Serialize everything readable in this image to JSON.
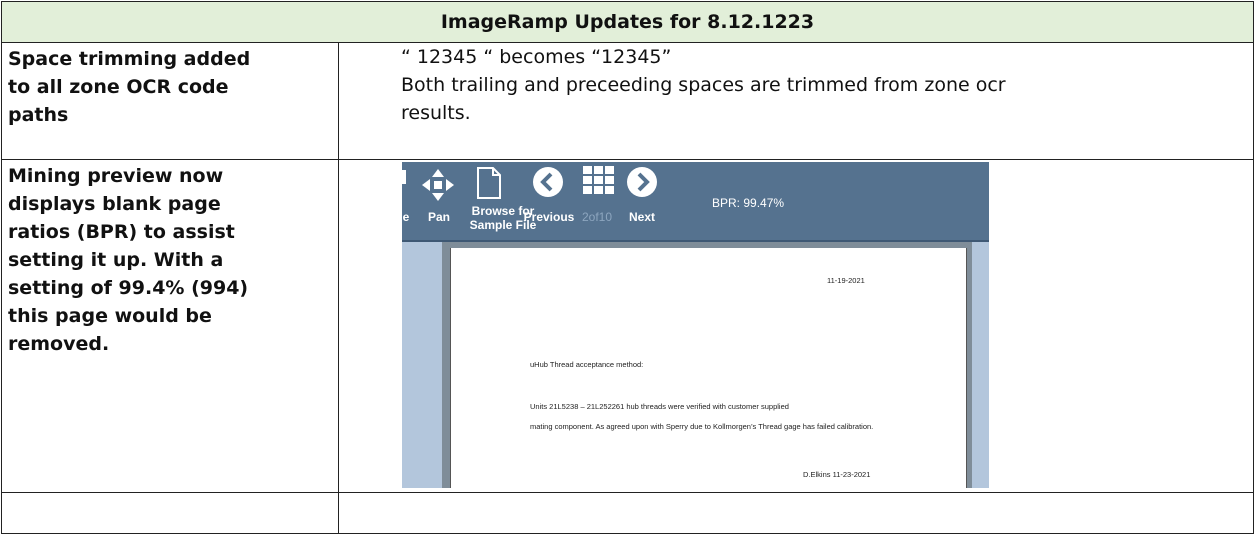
{
  "header": {
    "title": "ImageRamp Updates for 8.12.1223"
  },
  "rows": [
    {
      "label_lines": [
        "Space trimming added",
        "to all zone OCR code",
        "paths"
      ],
      "desc_lines": [
        "“ 12345 “ becomes “12345”",
        "Both trailing and preceeding spaces are trimmed from zone ocr",
        "results."
      ]
    },
    {
      "label_lines": [
        "Mining preview now",
        "displays blank page",
        "ratios (BPR) to assist",
        "setting it up.  With a",
        "setting of 99.4% (994)",
        "this page would be",
        "removed."
      ]
    }
  ],
  "screenshot": {
    "toolbar": {
      "cut_label": "e",
      "pan_label": "Pan",
      "browse_label_1": "Browse for",
      "browse_label_2": "Sample File",
      "previous_label": "Previous",
      "page_counter": "2of10",
      "next_label": "Next",
      "bpr_text": "BPR: 99.47%"
    },
    "page": {
      "date": "11-19-2021",
      "heading": "uHub Thread acceptance method:",
      "line1": "Units 21L5238 – 21L252261 hub threads were verified with customer supplied",
      "line2": "mating component.   As agreed upon with Sperry due to Kollmorgen’s Thread gage has failed calibration.",
      "signature": "D.Elkins  11-23-2021"
    }
  },
  "colors": {
    "header_bg": "#e2efd9",
    "toolbar_bg": "#55728f",
    "sidebar_bg": "#b3c6dc"
  }
}
